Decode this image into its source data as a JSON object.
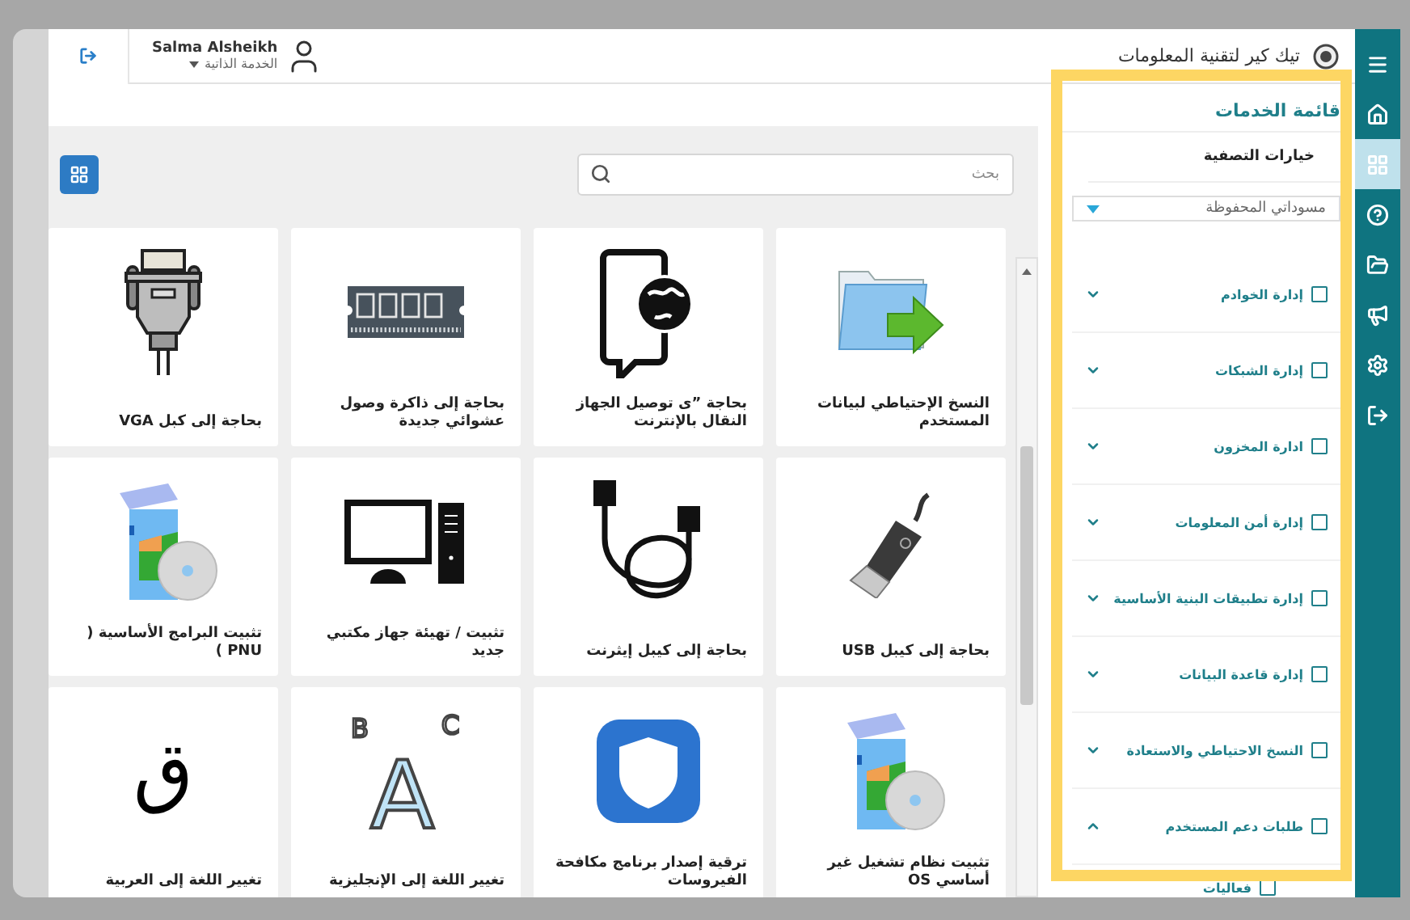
{
  "topbar": {
    "org_name": "تيك كير لتقنية المعلومات",
    "user_name": "Salma Alsheikh",
    "user_role": "الخدمة الذاتية"
  },
  "sidebar": {
    "items": [
      {
        "kind": "menu",
        "selected": false
      },
      {
        "kind": "home",
        "selected": false
      },
      {
        "kind": "grid",
        "selected": true
      },
      {
        "kind": "help",
        "selected": false
      },
      {
        "kind": "folder",
        "selected": false
      },
      {
        "kind": "megaphone",
        "selected": false
      },
      {
        "kind": "settings",
        "selected": false
      },
      {
        "kind": "logout",
        "selected": false
      }
    ]
  },
  "search": {
    "placeholder": "بحث"
  },
  "cards": [
    {
      "label": "النسخ الإحتياطي لبيانات المستخدم",
      "kind": "folder"
    },
    {
      "label": "بحاجة ”ى توصيل الجهاز النقال بالإنترنت",
      "kind": "phone"
    },
    {
      "label": "بحاجة إلى ذاكرة وصول عشوائي جديدة",
      "kind": "ram"
    },
    {
      "label": "بحاجة إلى كبل VGA",
      "kind": "vga"
    },
    {
      "label": "بحاجة إلى كيبل USB",
      "kind": "usb"
    },
    {
      "label": "بحاجة إلى كيبل إيثرنت",
      "kind": "cable"
    },
    {
      "label": "تثبيت / تهيئة جهاز مكتبي جديد",
      "kind": "computer"
    },
    {
      "label": "تثبيت البرامج الأساسية ( PNU )",
      "kind": "software"
    },
    {
      "label": "تثبيت نظام تشغيل غير أساسي OS",
      "kind": "software"
    },
    {
      "label": "ترقية إصدار برنامج مكافحة الفيروسات",
      "kind": "shield"
    },
    {
      "label": "تغيير اللغة إلى الإنجليزية",
      "kind": "letters",
      "glyphs": [
        "B",
        "A",
        "C"
      ]
    },
    {
      "label": "تغيير اللغة إلى العربية",
      "kind": "glyph",
      "glyphs": [
        "ق"
      ]
    }
  ],
  "filter_panel": {
    "title": "قائمة الخدمات",
    "subtitle": "خيارات التصفية",
    "dropdown": {
      "value": "مسوداتي المحفوظة"
    },
    "categories": [
      {
        "label": "إدارة الخوادم",
        "checked": false,
        "expanded": false
      },
      {
        "label": "إدارة الشبكات",
        "checked": false,
        "expanded": false
      },
      {
        "label": "ادارة المخزون",
        "checked": false,
        "expanded": false
      },
      {
        "label": "إدارة أمن المعلومات",
        "checked": false,
        "expanded": false
      },
      {
        "label": "إدارة تطبيقات البنية الأساسية",
        "checked": false,
        "expanded": false
      },
      {
        "label": "إدارة قاعدة البيانات",
        "checked": false,
        "expanded": false
      },
      {
        "label": "النسخ الاحتياطي والاستعادة",
        "checked": false,
        "expanded": false
      },
      {
        "label": "طلبات دعم المستخدم",
        "checked": false,
        "expanded": true,
        "children": [
          {
            "label": "فعاليات",
            "checked": false
          }
        ]
      }
    ]
  }
}
